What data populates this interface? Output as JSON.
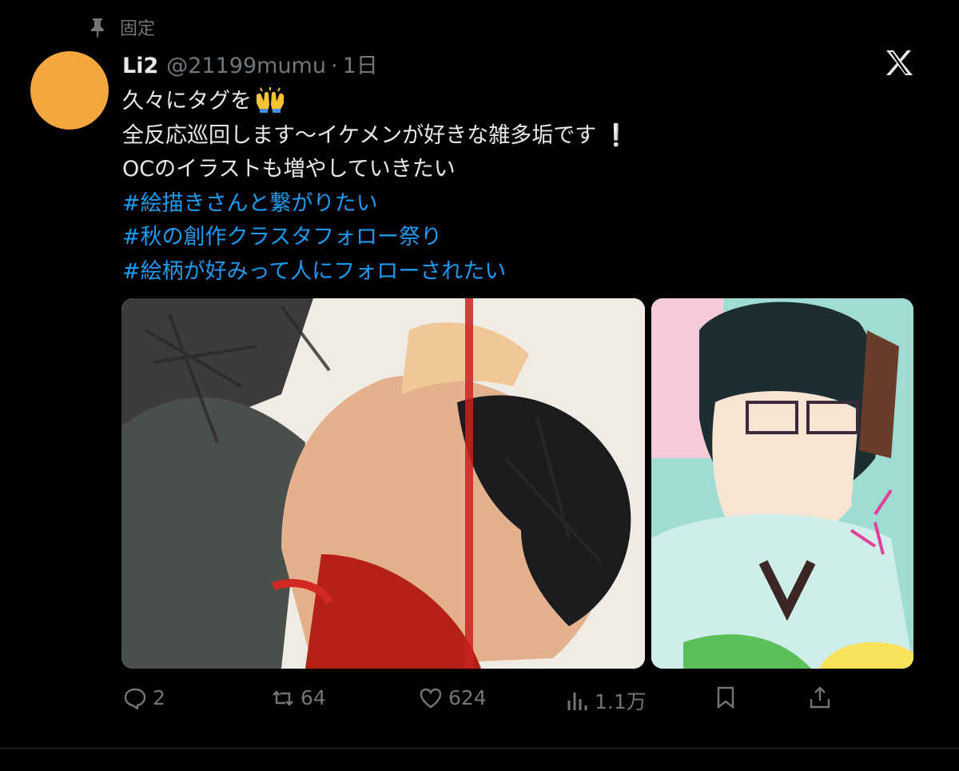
{
  "pinned": {
    "label": "固定",
    "icon": "pin-icon"
  },
  "author": {
    "name": "Li2",
    "handle": "@21199mumu",
    "separator": "·",
    "time": "1日",
    "avatar_color": "#f5a63e"
  },
  "post": {
    "lines": [
      {
        "text": "久々にタグを",
        "emoji": "raising-hands-emoji"
      },
      {
        "text": "全反応巡回します〜イケメンが好きな雑多垢です",
        "suffix": "❕"
      },
      {
        "text": "OCのイラストも増やしていきたい"
      }
    ],
    "hashtags": [
      "#絵描きさんと繋がりたい",
      "#秋の創作クラスタフォロー祭り",
      "#絵柄が好みって人にフォローされたい"
    ]
  },
  "media": [
    {
      "alt": "illustration-1",
      "accent": "#c8221f"
    },
    {
      "alt": "illustration-2",
      "accent": "#9fdcd4"
    }
  ],
  "actions": {
    "reply": "2",
    "repost": "64",
    "like": "624",
    "views": "1.1万"
  },
  "colors": {
    "background": "#000000",
    "text": "#e7e9ea",
    "muted": "#71767b",
    "link": "#1d9bf0"
  }
}
